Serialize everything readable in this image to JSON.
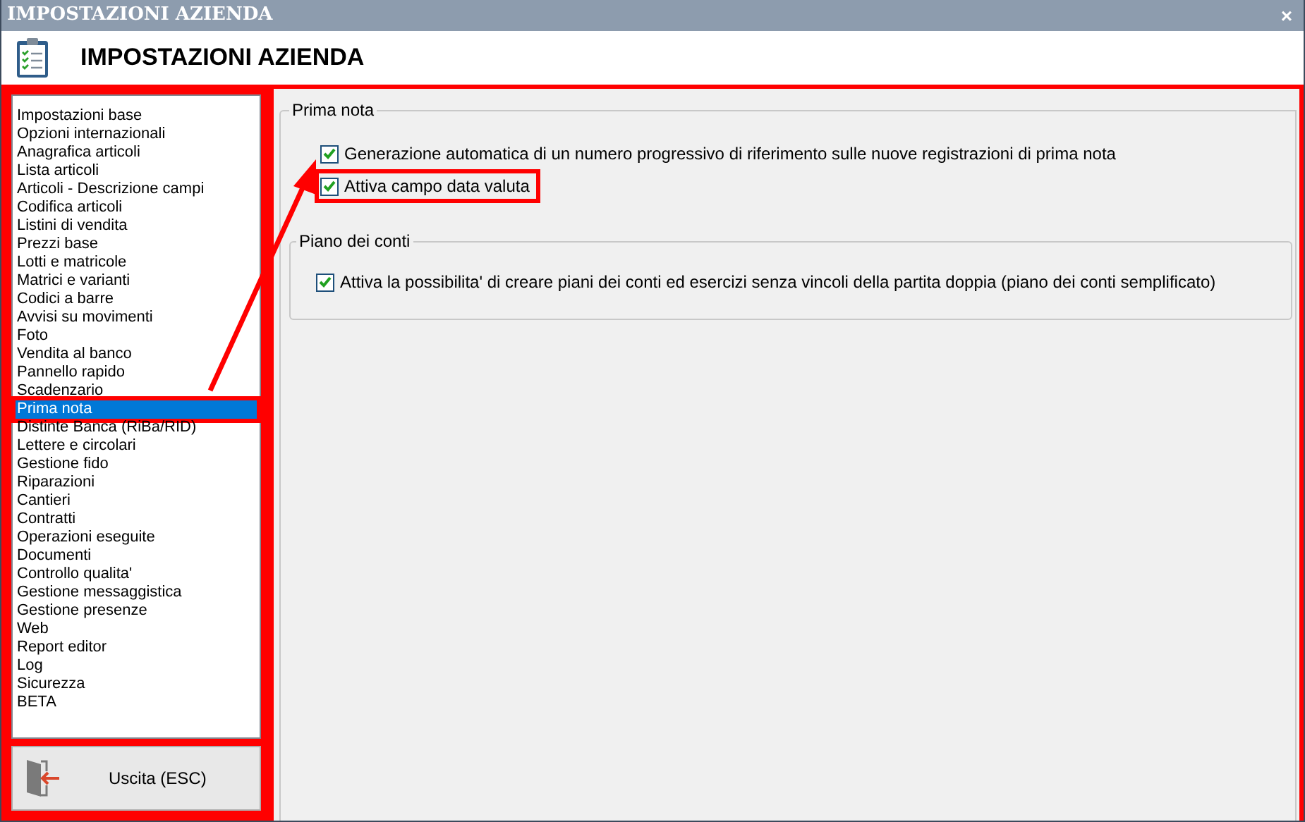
{
  "window": {
    "title": "IMPOSTAZIONI AZIENDA",
    "close": "×"
  },
  "header": {
    "title": "IMPOSTAZIONI AZIENDA"
  },
  "sidebar": {
    "items": [
      {
        "label": "Impostazioni base",
        "selected": false,
        "highlighted": false
      },
      {
        "label": "Opzioni internazionali",
        "selected": false,
        "highlighted": false
      },
      {
        "label": "Anagrafica articoli",
        "selected": false,
        "highlighted": false
      },
      {
        "label": "Lista articoli",
        "selected": false,
        "highlighted": false
      },
      {
        "label": "Articoli - Descrizione campi",
        "selected": false,
        "highlighted": false
      },
      {
        "label": "Codifica articoli",
        "selected": false,
        "highlighted": false
      },
      {
        "label": "Listini di vendita",
        "selected": false,
        "highlighted": false
      },
      {
        "label": "Prezzi base",
        "selected": false,
        "highlighted": false
      },
      {
        "label": "Lotti e matricole",
        "selected": false,
        "highlighted": false
      },
      {
        "label": "Matrici e varianti",
        "selected": false,
        "highlighted": false
      },
      {
        "label": "Codici a barre",
        "selected": false,
        "highlighted": false
      },
      {
        "label": "Avvisi su movimenti",
        "selected": false,
        "highlighted": false
      },
      {
        "label": "Foto",
        "selected": false,
        "highlighted": false
      },
      {
        "label": "Vendita al banco",
        "selected": false,
        "highlighted": false
      },
      {
        "label": "Pannello rapido",
        "selected": false,
        "highlighted": false
      },
      {
        "label": "Scadenzario",
        "selected": false,
        "highlighted": false
      },
      {
        "label": "Prima nota",
        "selected": true,
        "highlighted": true
      },
      {
        "label": "Distinte Banca (RiBa/RID)",
        "selected": false,
        "highlighted": false
      },
      {
        "label": "Lettere e circolari",
        "selected": false,
        "highlighted": false
      },
      {
        "label": "Gestione fido",
        "selected": false,
        "highlighted": false
      },
      {
        "label": "Riparazioni",
        "selected": false,
        "highlighted": false
      },
      {
        "label": "Cantieri",
        "selected": false,
        "highlighted": false
      },
      {
        "label": "Contratti",
        "selected": false,
        "highlighted": false
      },
      {
        "label": "Operazioni eseguite",
        "selected": false,
        "highlighted": false
      },
      {
        "label": "Documenti",
        "selected": false,
        "highlighted": false
      },
      {
        "label": "Controllo qualita'",
        "selected": false,
        "highlighted": false
      },
      {
        "label": "Gestione messaggistica",
        "selected": false,
        "highlighted": false
      },
      {
        "label": "Gestione presenze",
        "selected": false,
        "highlighted": false
      },
      {
        "label": "Web",
        "selected": false,
        "highlighted": false
      },
      {
        "label": "Report editor",
        "selected": false,
        "highlighted": false
      },
      {
        "label": "Log",
        "selected": false,
        "highlighted": false
      },
      {
        "label": "Sicurezza",
        "selected": false,
        "highlighted": false
      },
      {
        "label": "BETA",
        "selected": false,
        "highlighted": false
      }
    ]
  },
  "exit_button": {
    "label": "Uscita (ESC)"
  },
  "section": {
    "title": "Prima nota",
    "options": [
      {
        "label": "Generazione automatica di un numero progressivo di riferimento sulle nuove registrazioni di prima nota",
        "checked": true,
        "highlighted": false
      },
      {
        "label": "Attiva campo data valuta",
        "checked": true,
        "highlighted": true
      }
    ],
    "group": {
      "title": "Piano dei conti",
      "options": [
        {
          "label": "Attiva la possibilita' di creare piani dei conti ed esercizi senza vincoli della partita doppia (piano dei conti semplificato)",
          "checked": true,
          "highlighted": false
        }
      ]
    }
  }
}
